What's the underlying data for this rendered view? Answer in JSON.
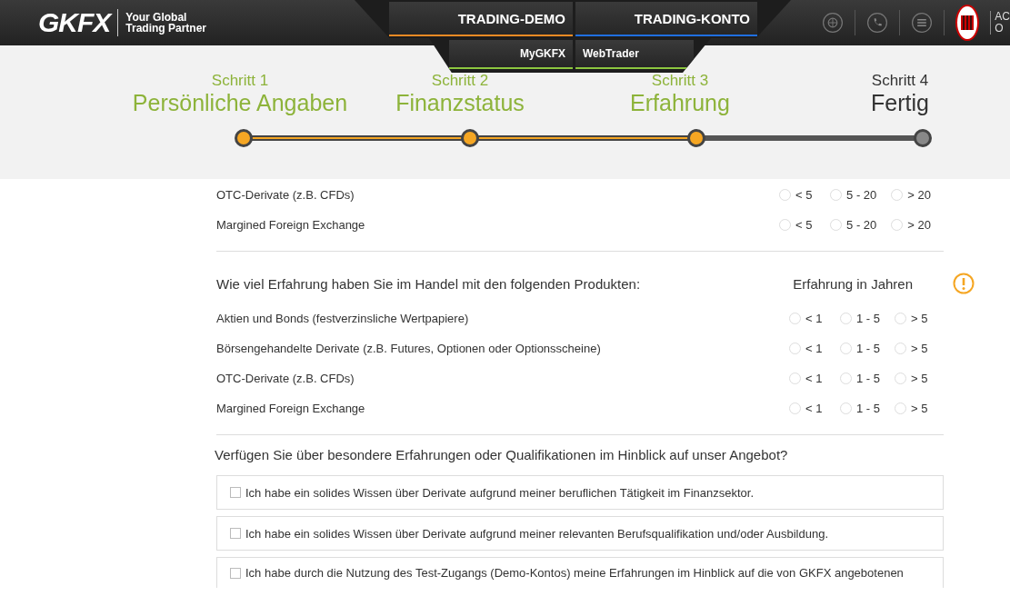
{
  "header": {
    "logo": "GKFX",
    "tagline_1": "Your Global",
    "tagline_2": "Trading Partner",
    "partner_1": "AC",
    "partner_2": "O"
  },
  "nav": {
    "primary": [
      {
        "label": "TRADING-DEMO",
        "color": "#f08a24"
      },
      {
        "label": "TRADING-KONTO",
        "color": "#1f6fe0"
      }
    ],
    "secondary": [
      {
        "label": "MyGKFX",
        "color": "#8cc63f"
      },
      {
        "label": "WebTrader",
        "color": "#8cc63f"
      }
    ]
  },
  "steps": [
    {
      "number": "Schritt 1",
      "title": "Persönliche Angaben",
      "completed": true
    },
    {
      "number": "Schritt 2",
      "title": "Finanzstatus",
      "completed": true
    },
    {
      "number": "Schritt 3",
      "title": "Erfahrung",
      "completed": true
    },
    {
      "number": "Schritt 4",
      "title": "Fertig",
      "completed": false
    }
  ],
  "section_trades": {
    "rows": [
      {
        "label": "OTC-Derivate (z.B. CFDs)",
        "options": [
          {
            "label": "< 5",
            "selected": false
          },
          {
            "label": "5 - 20",
            "selected": false
          },
          {
            "label": "> 20",
            "selected": false
          }
        ]
      },
      {
        "label": "Margined Foreign Exchange",
        "options": [
          {
            "label": "< 5",
            "selected": false
          },
          {
            "label": "5 - 20",
            "selected": false
          },
          {
            "label": "> 20",
            "selected": false
          }
        ]
      }
    ]
  },
  "section_experience": {
    "question": "Wie viel Erfahrung haben Sie im Handel mit den folgenden Produkten:",
    "column_header": "Erfahrung in Jahren",
    "rows": [
      {
        "label": "Aktien und Bonds (festverzinsliche Wertpapiere)",
        "options": [
          {
            "label": "< 1",
            "selected": false
          },
          {
            "label": "1 - 5",
            "selected": false
          },
          {
            "label": "> 5",
            "selected": false
          }
        ]
      },
      {
        "label": "Börsengehandelte Derivate (z.B. Futures, Optionen oder Optionsscheine)",
        "options": [
          {
            "label": "< 1",
            "selected": false
          },
          {
            "label": "1 - 5",
            "selected": false
          },
          {
            "label": "> 5",
            "selected": false
          }
        ]
      },
      {
        "label": "OTC-Derivate (z.B. CFDs)",
        "options": [
          {
            "label": "< 1",
            "selected": false
          },
          {
            "label": "1 - 5",
            "selected": false
          },
          {
            "label": "> 5",
            "selected": false
          }
        ]
      },
      {
        "label": "Margined Foreign Exchange",
        "options": [
          {
            "label": "< 1",
            "selected": false
          },
          {
            "label": "1 - 5",
            "selected": false
          },
          {
            "label": "> 5",
            "selected": false
          }
        ]
      }
    ]
  },
  "section_qualifications": {
    "question": "Verfügen Sie über besondere Erfahrungen oder Qualifikationen im Hinblick auf unser Angebot?",
    "options": [
      {
        "label": "Ich habe ein solides Wissen über Derivate aufgrund meiner beruflichen Tätigkeit im Finanzsektor.",
        "checked": false
      },
      {
        "label": "Ich habe ein solides Wissen über Derivate aufgrund meiner relevanten Berufsqualifikation und/oder Ausbildung.",
        "checked": false
      },
      {
        "label": "Ich habe durch die Nutzung des Test-Zugangs (Demo-Kontos) meine Erfahrungen im Hinblick auf die von GKFX angebotenen",
        "checked": false
      }
    ]
  }
}
